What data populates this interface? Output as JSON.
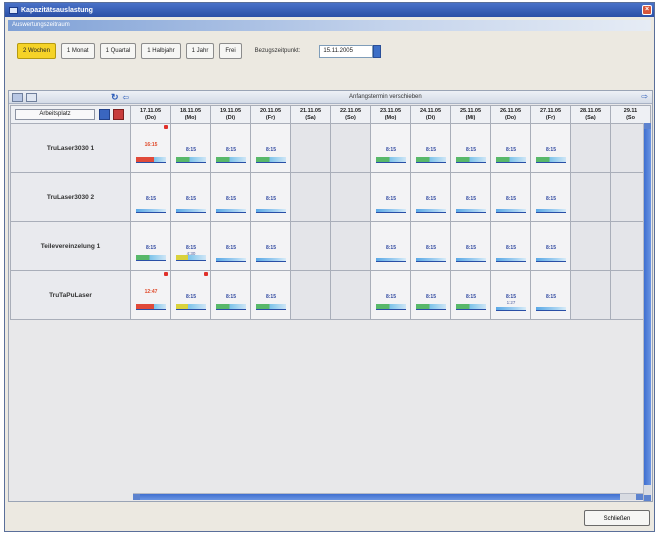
{
  "window": {
    "title": "Kapazitätsauslastung"
  },
  "section": {
    "title": "Auswertungszeitraum"
  },
  "toolbar": {
    "periods": [
      "2 Wochen",
      "1 Monat",
      "1 Quartal",
      "1 Halbjahr",
      "1 Jahr",
      "Frei"
    ],
    "active_period": "2 Wochen",
    "ref_label": "Bezugszeitpunkt:",
    "ref_date": "15.11.2005"
  },
  "grid": {
    "toolbar_label": "Anfangstermin verschieben",
    "workstation_header": "Arbeitsplatz",
    "days": [
      {
        "date": "17.11.05",
        "wd": "(Do)"
      },
      {
        "date": "18.11.05",
        "wd": "(Mo)"
      },
      {
        "date": "19.11.05",
        "wd": "(Di)"
      },
      {
        "date": "20.11.05",
        "wd": "(Fr)"
      },
      {
        "date": "21.11.05",
        "wd": "(Sa)"
      },
      {
        "date": "22.11.05",
        "wd": "(So)"
      },
      {
        "date": "23.11.05",
        "wd": "(Mo)"
      },
      {
        "date": "24.11.05",
        "wd": "(Di)"
      },
      {
        "date": "25.11.05",
        "wd": "(Mi)"
      },
      {
        "date": "26.11.05",
        "wd": "(Do)"
      },
      {
        "date": "27.11.05",
        "wd": "(Fr)"
      },
      {
        "date": "28.11.05",
        "wd": "(Sa)"
      },
      {
        "date": "29.11",
        "wd": "(So"
      }
    ],
    "rows": [
      {
        "name": "TruLaser3030 1",
        "cells": [
          {
            "v": "16:15",
            "bar": "r",
            "mark": true,
            "red": true
          },
          {
            "v": "8:15",
            "bar": "g"
          },
          {
            "v": "8:15",
            "bar": "g"
          },
          {
            "v": "8:15",
            "bar": "g"
          },
          {
            "v": "",
            "bar": "",
            "weekend": true
          },
          {
            "v": "",
            "bar": "",
            "weekend": true
          },
          {
            "v": "8:15",
            "bar": "g"
          },
          {
            "v": "8:15",
            "bar": "g"
          },
          {
            "v": "8:15",
            "bar": "g"
          },
          {
            "v": "8:15",
            "bar": "g"
          },
          {
            "v": "8:15",
            "bar": "g"
          },
          {
            "v": "",
            "bar": "",
            "weekend": true
          },
          {
            "v": "",
            "bar": "",
            "weekend": true
          }
        ]
      },
      {
        "name": "TruLaser3030 2",
        "cells": [
          {
            "v": "8:15",
            "bar": "b"
          },
          {
            "v": "8:15",
            "bar": "b"
          },
          {
            "v": "8:15",
            "bar": "b"
          },
          {
            "v": "8:15",
            "bar": "b"
          },
          {
            "v": "",
            "bar": "",
            "weekend": true
          },
          {
            "v": "",
            "bar": "",
            "weekend": true
          },
          {
            "v": "8:15",
            "bar": "b"
          },
          {
            "v": "8:15",
            "bar": "b"
          },
          {
            "v": "8:15",
            "bar": "b"
          },
          {
            "v": "8:15",
            "bar": "b"
          },
          {
            "v": "8:15",
            "bar": "b"
          },
          {
            "v": "",
            "bar": "",
            "weekend": true
          },
          {
            "v": "",
            "bar": "",
            "weekend": true
          }
        ]
      },
      {
        "name": "Teilevereinzelung 1",
        "cells": [
          {
            "v": "8:15",
            "bar": "g"
          },
          {
            "v": "8:15",
            "sub": "4:30",
            "bar": "y"
          },
          {
            "v": "8:15",
            "bar": "b"
          },
          {
            "v": "8:15",
            "bar": "b"
          },
          {
            "v": "",
            "bar": "",
            "weekend": true
          },
          {
            "v": "",
            "bar": "",
            "weekend": true
          },
          {
            "v": "8:15",
            "bar": "b"
          },
          {
            "v": "8:15",
            "bar": "b"
          },
          {
            "v": "8:15",
            "bar": "b"
          },
          {
            "v": "8:15",
            "bar": "b"
          },
          {
            "v": "8:15",
            "bar": "b"
          },
          {
            "v": "",
            "bar": "",
            "weekend": true
          },
          {
            "v": "",
            "bar": "",
            "weekend": true
          }
        ]
      },
      {
        "name": "TruTaPuLaser",
        "cells": [
          {
            "v": "12:47",
            "bar": "r",
            "mark": true,
            "red": true
          },
          {
            "v": "8:15",
            "bar": "y",
            "mark": true
          },
          {
            "v": "8:15",
            "bar": "g"
          },
          {
            "v": "8:15",
            "bar": "g"
          },
          {
            "v": "",
            "bar": "",
            "weekend": true
          },
          {
            "v": "",
            "bar": "",
            "weekend": true
          },
          {
            "v": "8:15",
            "bar": "g"
          },
          {
            "v": "8:15",
            "bar": "g"
          },
          {
            "v": "8:15",
            "bar": "g"
          },
          {
            "v": "8:15",
            "sub": "1:27",
            "bar": "b"
          },
          {
            "v": "8:15",
            "bar": "b"
          },
          {
            "v": "",
            "bar": "",
            "weekend": true
          },
          {
            "v": "",
            "bar": "",
            "weekend": true
          }
        ]
      }
    ]
  },
  "footer": {
    "close_label": "Schließen"
  }
}
